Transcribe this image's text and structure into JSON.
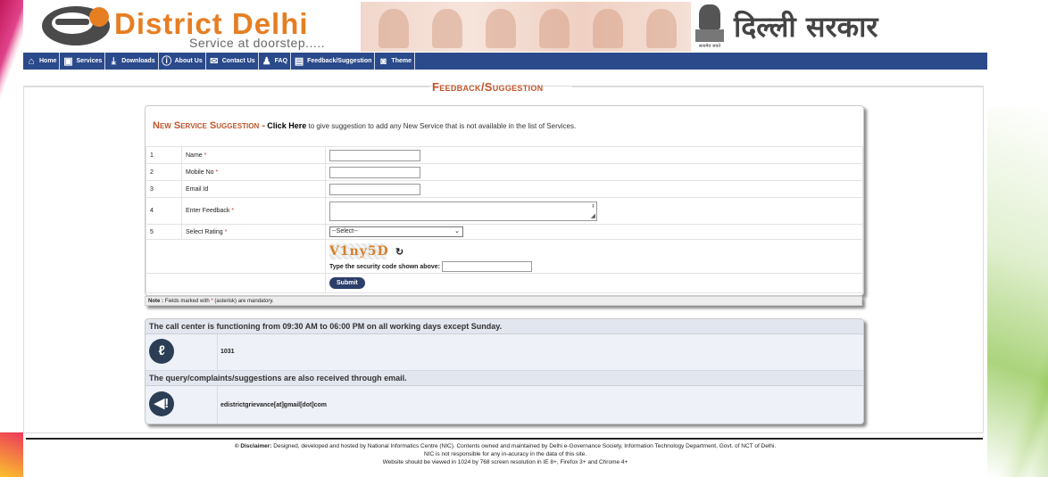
{
  "header": {
    "brand": "District Delhi",
    "tagline": "Service at doorstep.....",
    "gov_name": "दिल्ली सरकार",
    "emblem_text": "सत्यमेव जयते"
  },
  "nav": {
    "items": [
      {
        "label": "Home",
        "icon": "home-icon"
      },
      {
        "label": "Services",
        "icon": "briefcase-icon"
      },
      {
        "label": "Downloads",
        "icon": "download-icon"
      },
      {
        "label": "About Us",
        "icon": "info-icon"
      },
      {
        "label": "Contact Us",
        "icon": "envelope-icon"
      },
      {
        "label": "FAQ",
        "icon": "people-icon"
      },
      {
        "label": "Feedback/Suggestion",
        "icon": "document-icon"
      },
      {
        "label": "Theme",
        "icon": "camera-icon"
      }
    ]
  },
  "page_title": "Feedback/Suggestion",
  "suggestion": {
    "title": "New Service Suggestion -",
    "link": "Click Here",
    "text": "to give suggestion to add any New Service that is not available in the list of Services."
  },
  "form": {
    "rows": [
      {
        "num": "1",
        "label": "Name",
        "required": "*"
      },
      {
        "num": "2",
        "label": "Mobile No",
        "required": "*"
      },
      {
        "num": "3",
        "label": "Email Id",
        "required": ""
      },
      {
        "num": "4",
        "label": "Enter Feedback",
        "required": "*"
      },
      {
        "num": "5",
        "label": "Select Rating",
        "required": "*"
      }
    ],
    "rating_selected": "--Select--",
    "captcha_text": "V1ny5D",
    "captcha_label": "Type the security code shown above:",
    "submit_label": "Submit"
  },
  "note": {
    "label": "Note :",
    "text": "Fields marked with",
    "star": "*",
    "text2": "(asterisk) are mandatory."
  },
  "call_center": {
    "heading": "The call center is functioning from 09:30 AM to 06:00 PM on all working days except Sunday.",
    "phone": "1031",
    "email_heading": "The query/complaints/suggestions are also received through email.",
    "email": "edistrictgrievance[at]gmail[dot]com"
  },
  "footer": {
    "disclaimer_label": "© Disclaimer:",
    "line1": "Designed, developed and hosted by National Informatics Centre (NIC). Contents owned and maintained by Delhi e-Governance Society, Information Technology Department, Govt. of NCT of Delhi.",
    "line2": "NIC is not responsible for any in-acuracy in the data of this site.",
    "line3": "Website should be viewed in 1024 by 768 screen resolution in IE 8+, Firefox 3+ and Chrome 4+"
  }
}
